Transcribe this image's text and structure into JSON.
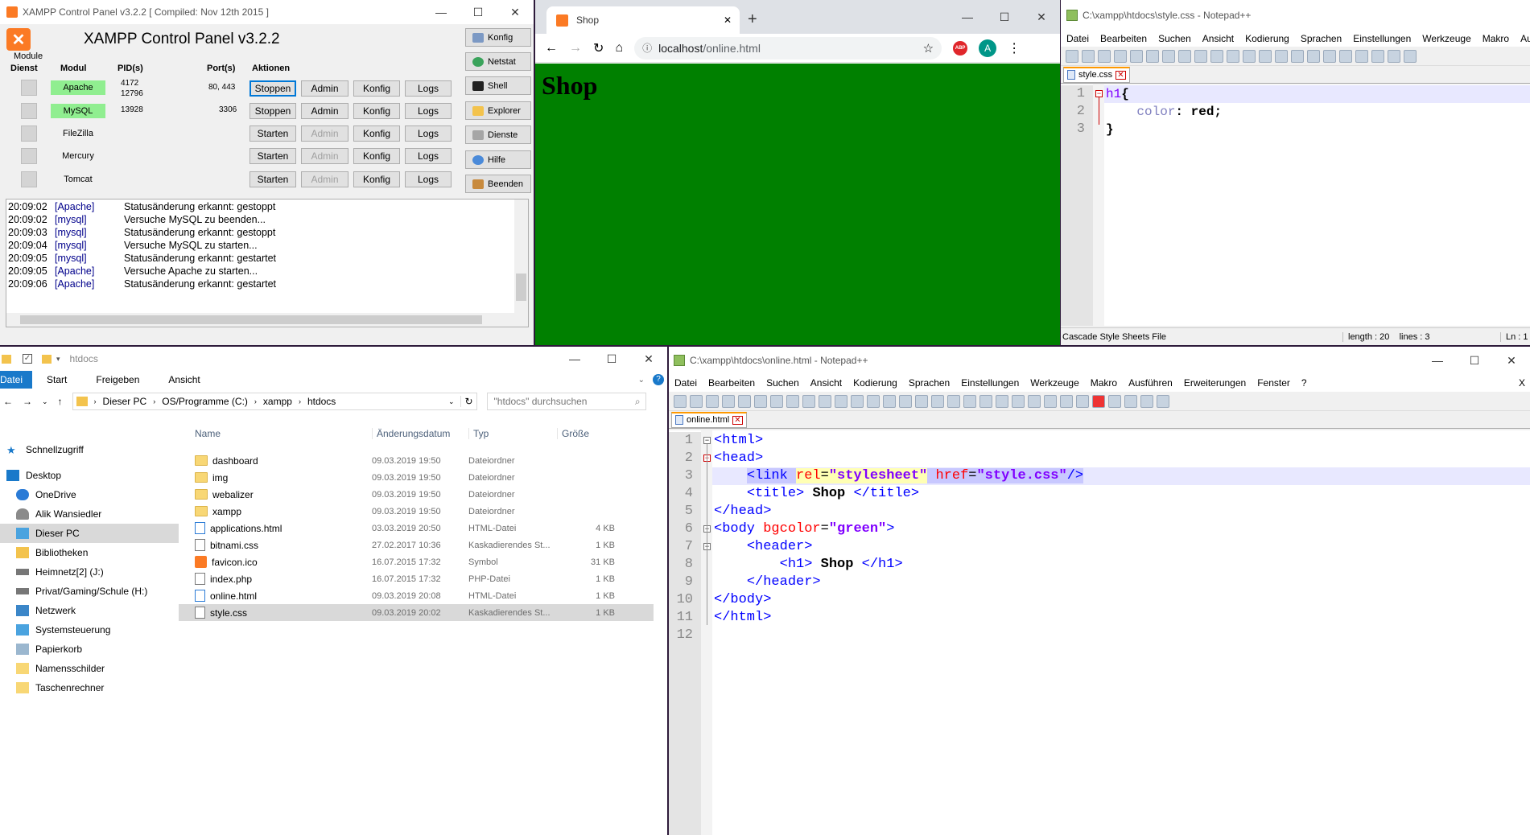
{
  "xampp": {
    "title": "XAMPP Control Panel v3.2.2   [ Compiled: Nov 12th 2015 ]",
    "header": "XAMPP Control Panel v3.2.2",
    "modules_label": "Module",
    "cols": {
      "dienst": "Dienst",
      "modul": "Modul",
      "pid": "PID(s)",
      "port": "Port(s)",
      "aktionen": "Aktionen"
    },
    "rows": [
      {
        "modul": "Apache",
        "pid": "4172\n12796",
        "port": "80, 443",
        "action": "Stoppen",
        "admin": "Admin",
        "konfig": "Konfig",
        "logs": "Logs"
      },
      {
        "modul": "MySQL",
        "pid": "13928",
        "port": "3306",
        "action": "Stoppen",
        "admin": "Admin",
        "konfig": "Konfig",
        "logs": "Logs"
      },
      {
        "modul": "FileZilla",
        "pid": "",
        "port": "",
        "action": "Starten",
        "admin": "Admin",
        "konfig": "Konfig",
        "logs": "Logs"
      },
      {
        "modul": "Mercury",
        "pid": "",
        "port": "",
        "action": "Starten",
        "admin": "Admin",
        "konfig": "Konfig",
        "logs": "Logs"
      },
      {
        "modul": "Tomcat",
        "pid": "",
        "port": "",
        "action": "Starten",
        "admin": "Admin",
        "konfig": "Konfig",
        "logs": "Logs"
      }
    ],
    "side_buttons": [
      "Konfig",
      "Netstat",
      "Shell",
      "Explorer",
      "Dienste",
      "Hilfe",
      "Beenden"
    ],
    "log": [
      {
        "t": "20:09:02",
        "m": "[Apache]",
        "x": "Statusänderung erkannt: gestoppt"
      },
      {
        "t": "20:09:02",
        "m": "[mysql]",
        "x": "Versuche MySQL zu beenden..."
      },
      {
        "t": "20:09:03",
        "m": "[mysql]",
        "x": "Statusänderung erkannt: gestoppt"
      },
      {
        "t": "20:09:04",
        "m": "[mysql]",
        "x": "Versuche MySQL zu starten..."
      },
      {
        "t": "20:09:05",
        "m": "[mysql]",
        "x": "Statusänderung erkannt: gestartet"
      },
      {
        "t": "20:09:05",
        "m": "[Apache]",
        "x": "Versuche Apache zu starten..."
      },
      {
        "t": "20:09:06",
        "m": "[Apache]",
        "x": "Statusänderung erkannt: gestartet"
      }
    ]
  },
  "browser": {
    "tab_title": "Shop",
    "url_host": "localhost",
    "url_path": "/online.html",
    "heading": "Shop",
    "page_bg": "#008000",
    "abp": "ABP",
    "avatar": "A"
  },
  "np_css": {
    "title": "C:\\xampp\\htdocs\\style.css - Notepad++",
    "menu": [
      "Datei",
      "Bearbeiten",
      "Suchen",
      "Ansicht",
      "Kodierung",
      "Sprachen",
      "Einstellungen",
      "Werkzeuge",
      "Makro",
      "Aus"
    ],
    "tab": "style.css",
    "line_numbers": [
      "1",
      "2",
      "3"
    ],
    "status_type": "Cascade Style Sheets File",
    "status_len": "length : 20    lines : 3",
    "status_ln": "Ln : 1"
  },
  "np_html": {
    "title": "C:\\xampp\\htdocs\\online.html - Notepad++",
    "menu": [
      "Datei",
      "Bearbeiten",
      "Suchen",
      "Ansicht",
      "Kodierung",
      "Sprachen",
      "Einstellungen",
      "Werkzeuge",
      "Makro",
      "Ausführen",
      "Erweiterungen",
      "Fenster",
      "?"
    ],
    "close_x": "X",
    "tab": "online.html",
    "line_numbers": [
      "1",
      "2",
      "3",
      "4",
      "5",
      "6",
      "7",
      "8",
      "9",
      "10",
      "11",
      "12"
    ]
  },
  "explorer": {
    "title": "htdocs",
    "ribbon": [
      "Datei",
      "Start",
      "Freigeben",
      "Ansicht"
    ],
    "path": [
      "Dieser PC",
      "OS/Programme (C:)",
      "xampp",
      "htdocs"
    ],
    "search_placeholder": "\"htdocs\" durchsuchen",
    "cols": {
      "name": "Name",
      "date": "Änderungsdatum",
      "type": "Typ",
      "size": "Größe"
    },
    "nav": [
      "Schnellzugriff",
      "Desktop",
      "OneDrive",
      "Alik Wansiedler",
      "Dieser PC",
      "Bibliotheken",
      "Heimnetz[2] (J:)",
      "Privat/Gaming/Schule (H:)",
      "Netzwerk",
      "Systemsteuerung",
      "Papierkorb",
      "Namensschilder",
      "Taschenrechner"
    ],
    "files": [
      {
        "name": "dashboard",
        "date": "09.03.2019 19:50",
        "type": "Dateiordner",
        "size": "",
        "kind": "folder"
      },
      {
        "name": "img",
        "date": "09.03.2019 19:50",
        "type": "Dateiordner",
        "size": "",
        "kind": "folder"
      },
      {
        "name": "webalizer",
        "date": "09.03.2019 19:50",
        "type": "Dateiordner",
        "size": "",
        "kind": "folder"
      },
      {
        "name": "xampp",
        "date": "09.03.2019 19:50",
        "type": "Dateiordner",
        "size": "",
        "kind": "folder"
      },
      {
        "name": "applications.html",
        "date": "03.03.2019 20:50",
        "type": "HTML-Datei",
        "size": "4 KB",
        "kind": "file"
      },
      {
        "name": "bitnami.css",
        "date": "27.02.2017 10:36",
        "type": "Kaskadierendes St...",
        "size": "1 KB",
        "kind": "file"
      },
      {
        "name": "favicon.ico",
        "date": "16.07.2015 17:32",
        "type": "Symbol",
        "size": "31 KB",
        "kind": "ico"
      },
      {
        "name": "index.php",
        "date": "16.07.2015 17:32",
        "type": "PHP-Datei",
        "size": "1 KB",
        "kind": "file"
      },
      {
        "name": "online.html",
        "date": "09.03.2019 20:08",
        "type": "HTML-Datei",
        "size": "1 KB",
        "kind": "file"
      },
      {
        "name": "style.css",
        "date": "09.03.2019 20:02",
        "type": "Kaskadierendes St...",
        "size": "1 KB",
        "kind": "file"
      }
    ]
  }
}
